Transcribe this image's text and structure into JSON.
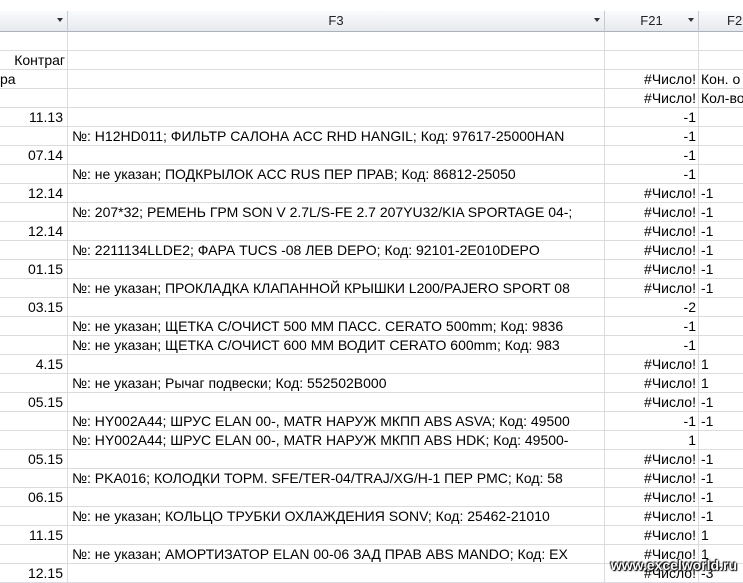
{
  "columns": [
    {
      "label": ""
    },
    {
      "label": "F3"
    },
    {
      "label": "F21"
    },
    {
      "label": "F2"
    }
  ],
  "rows": [
    {
      "c0": "",
      "c1": "",
      "c2": "",
      "c3": ""
    },
    {
      "c0": "Контраг",
      "c1": "",
      "c2": "",
      "c3": ""
    },
    {
      "c0": "ра",
      "c1": "",
      "c2": "#Число!",
      "c3": "Кон. о"
    },
    {
      "c0": "",
      "c1": "",
      "c2": "#Число!",
      "c3": "Кол-во"
    },
    {
      "c0": "11.13",
      "c1": "",
      "c2": "-1",
      "c3": ""
    },
    {
      "c0": "",
      "c1": "№: H12HD011;   ФИЛЬТР САЛОНА ACC RHD HANGIL;   Код: 97617-25000HAN",
      "c2": "-1",
      "c3": ""
    },
    {
      "c0": "07.14",
      "c1": "",
      "c2": "-1",
      "c3": ""
    },
    {
      "c0": "",
      "c1": "№: не указан;   ПОДКРЫЛОК ACC RUS ПЕР ПРАВ;   Код: 86812-25050",
      "c2": "-1",
      "c3": ""
    },
    {
      "c0": "12.14",
      "c1": "",
      "c2": "#Число!",
      "c3": "-1"
    },
    {
      "c0": "",
      "c1": "№: 207*32;   РЕМЕНЬ ГРМ SON V 2.7L/S-FE 2.7 207YU32/KIA SPORTAGE 04-;",
      "c2": "#Число!",
      "c3": "-1"
    },
    {
      "c0": "12.14",
      "c1": "",
      "c2": "#Число!",
      "c3": "-1"
    },
    {
      "c0": "",
      "c1": "№: 2211134LLDE2;   ФАРА TUCS -08 ЛЕВ DEPO;   Код: 92101-2E010DEPO",
      "c2": "#Число!",
      "c3": "-1"
    },
    {
      "c0": "01.15",
      "c1": "",
      "c2": "#Число!",
      "c3": "-1"
    },
    {
      "c0": "",
      "c1": "№: не указан;   ПРОКЛАДКА КЛАПАННОЙ КРЫШКИ L200/PAJERO SPORT 08",
      "c2": "#Число!",
      "c3": "-1"
    },
    {
      "c0": "03.15",
      "c1": "",
      "c2": "-2",
      "c3": ""
    },
    {
      "c0": "",
      "c1": "№: не указан;   ЩЕТКА С/ОЧИСТ 500 ММ ПАСС. CERATO 500mm;   Код: 9836",
      "c2": "-1",
      "c3": ""
    },
    {
      "c0": "",
      "c1": "№: не указан;   ЩЕТКА С/ОЧИСТ 600 ММ ВОДИТ CERATO 600mm;   Код: 983",
      "c2": "-1",
      "c3": ""
    },
    {
      "c0": "4.15",
      "c1": "",
      "c2": "#Число!",
      "c3": "1"
    },
    {
      "c0": "",
      "c1": "№: не указан;   Рычаг подвески;   Код: 552502B000",
      "c2": "#Число!",
      "c3": "1"
    },
    {
      "c0": "05.15",
      "c1": "",
      "c2": "#Число!",
      "c3": "-1"
    },
    {
      "c0": "",
      "c1": "№: HY002A44;   ШРУС ELAN 00-, MATR НАРУЖ МКПП ABS ASVA;   Код: 49500",
      "c2": "-1",
      "c3": "-1"
    },
    {
      "c0": "",
      "c1": "№: HY002A44;   ШРУС ELAN 00-, MATR НАРУЖ МКПП ABS HDK;   Код: 49500-",
      "c2": "1",
      "c3": ""
    },
    {
      "c0": "05.15",
      "c1": "",
      "c2": "#Число!",
      "c3": "-1"
    },
    {
      "c0": "",
      "c1": "№: PKA016;   КОЛОДКИ ТОРМ. SFE/TER-04/TRAJ/XG/H-1 ПЕР PMC;   Код: 58",
      "c2": "#Число!",
      "c3": "-1"
    },
    {
      "c0": "06.15",
      "c1": "",
      "c2": "#Число!",
      "c3": "-1"
    },
    {
      "c0": "",
      "c1": "№: не указан;   КОЛЬЦО ТРУБКИ ОХЛАЖДЕНИЯ SONV;   Код: 25462-21010",
      "c2": "#Число!",
      "c3": "-1"
    },
    {
      "c0": "11.15",
      "c1": "",
      "c2": "#Число!",
      "c3": "1"
    },
    {
      "c0": "",
      "c1": "№: не указан;   АМОРТИЗАТОР ELAN 00-06 ЗАД ПРАВ ABS MANDO;   Код: EX",
      "c2": "#Число!",
      "c3": "1"
    },
    {
      "c0": "12.15",
      "c1": "",
      "c2": "#Число!",
      "c3": "-3"
    }
  ],
  "watermark": "www.excelworld.ru"
}
